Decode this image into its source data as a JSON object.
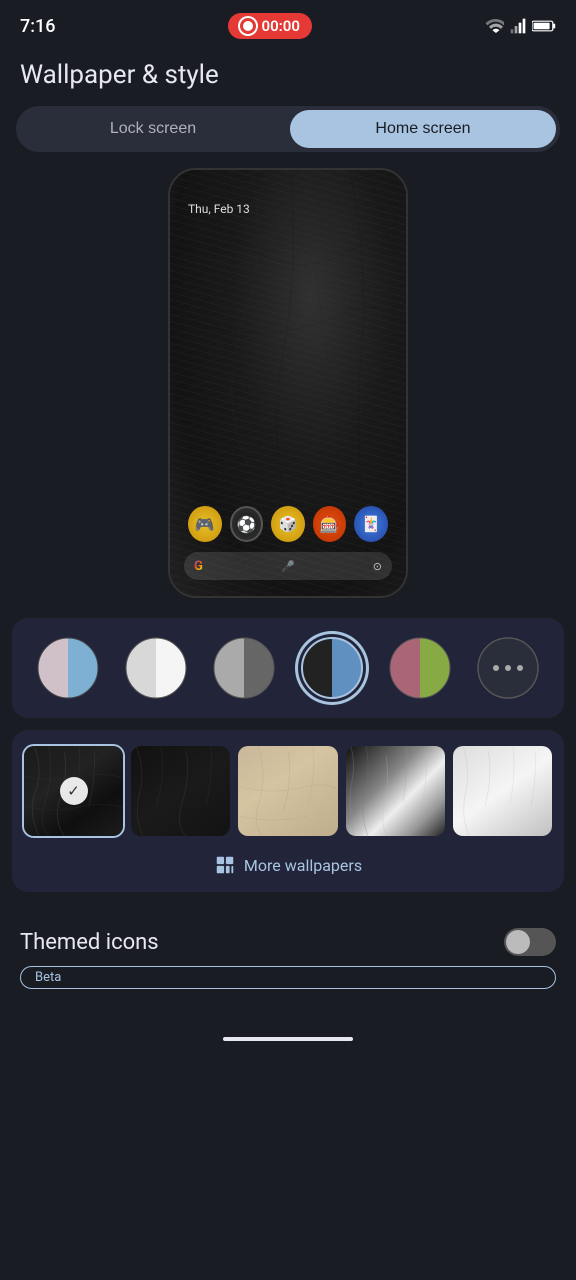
{
  "statusBar": {
    "time": "7:16",
    "recording": "00:00"
  },
  "header": {
    "title": "Wallpaper & style"
  },
  "tabs": {
    "lockScreen": "Lock screen",
    "homeScreen": "Home screen",
    "activeTab": "homeScreen"
  },
  "phonePreview": {
    "date": "Thu, Feb 13"
  },
  "palette": {
    "options": [
      {
        "id": "p1",
        "label": "blue-grey split"
      },
      {
        "id": "p2",
        "label": "white"
      },
      {
        "id": "p3",
        "label": "dark grey"
      },
      {
        "id": "p4",
        "label": "blue-dark split",
        "selected": true
      },
      {
        "id": "p5",
        "label": "green-pink split"
      },
      {
        "id": "p6",
        "label": "more options"
      }
    ]
  },
  "wallpapers": {
    "moreLabel": "More wallpapers",
    "items": [
      {
        "id": "w1",
        "label": "dark feather",
        "selected": true
      },
      {
        "id": "w2",
        "label": "dark feather 2",
        "selected": false
      },
      {
        "id": "w3",
        "label": "sand texture",
        "selected": false
      },
      {
        "id": "w4",
        "label": "black white fur",
        "selected": false
      },
      {
        "id": "w5",
        "label": "light feather",
        "selected": false
      }
    ]
  },
  "themedIcons": {
    "label": "Themed icons",
    "betaLabel": "Beta",
    "enabled": false
  },
  "icons": {
    "check": "✓",
    "more": "⋯"
  }
}
